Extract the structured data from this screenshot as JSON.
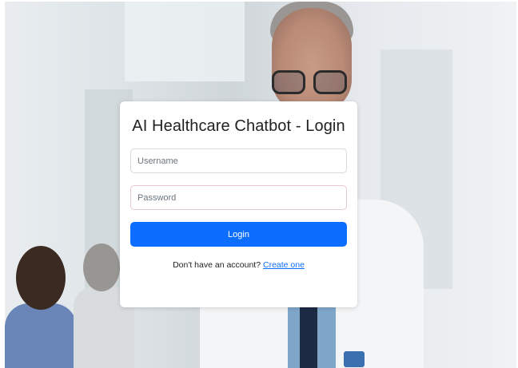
{
  "login": {
    "title": "AI Healthcare Chatbot - Login",
    "username_placeholder": "Username",
    "password_placeholder": "Password",
    "button_label": "Login",
    "signup_prompt": "Don't have an account?",
    "signup_link": "Create one"
  },
  "colors": {
    "accent": "#0d6efd",
    "card_background": "#ffffff"
  }
}
